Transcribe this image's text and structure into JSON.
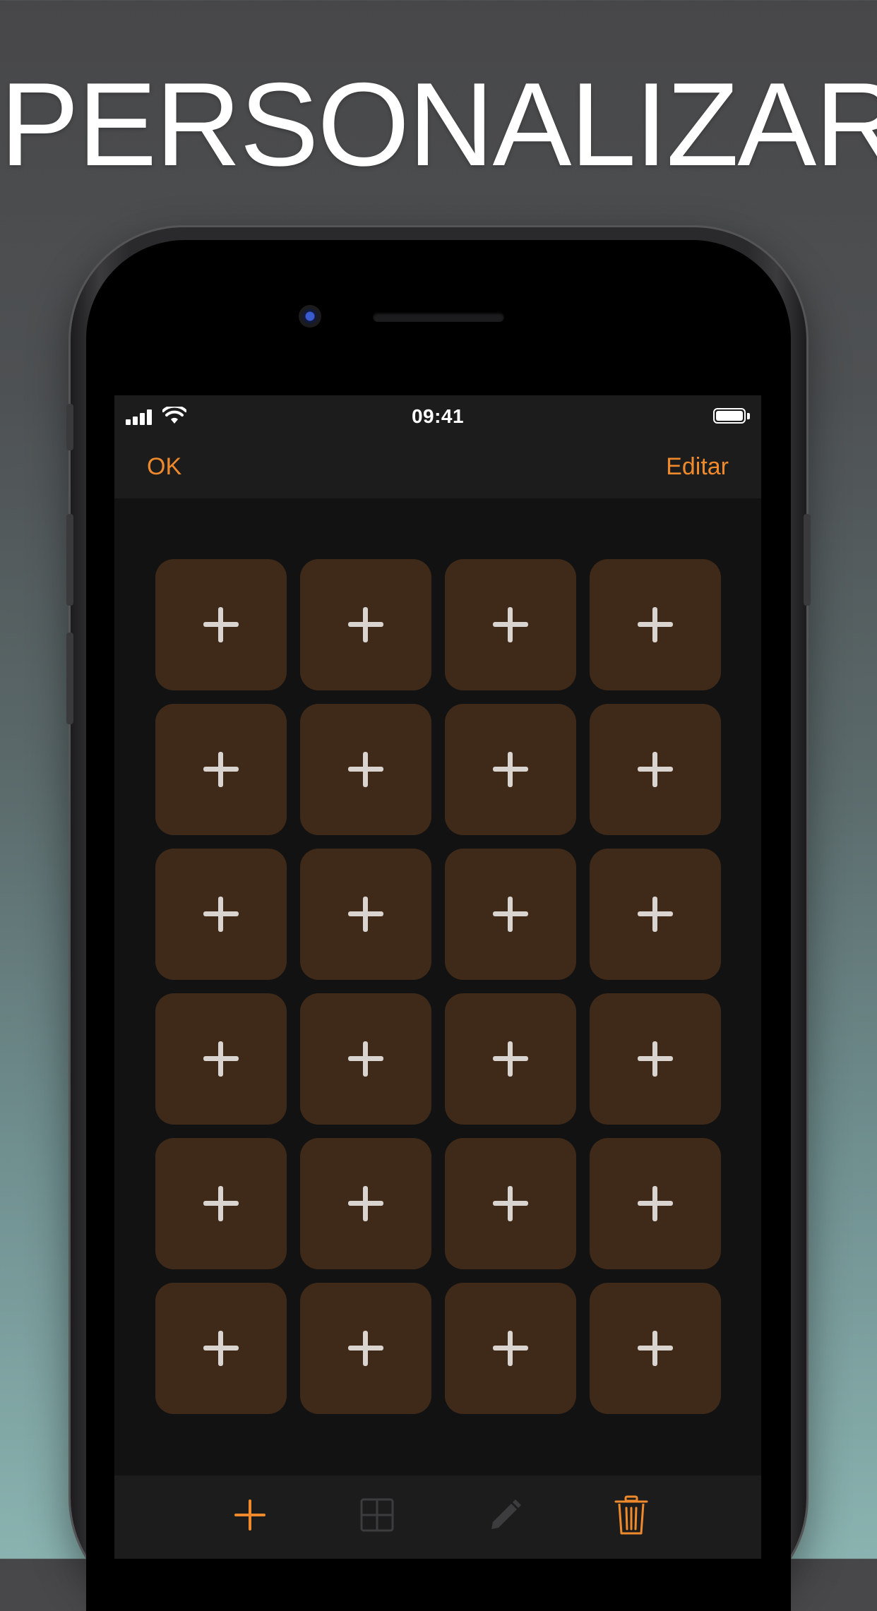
{
  "headline": "PERSONALIZAR",
  "status_bar": {
    "time": "09:41",
    "signal_icon": "cellular-signal-icon",
    "wifi_icon": "wifi-icon",
    "battery_icon": "battery-icon"
  },
  "nav": {
    "left_label": "OK",
    "right_label": "Editar"
  },
  "grid": {
    "rows": 6,
    "columns": 4,
    "tile_icon": "plus-icon"
  },
  "toolbar": {
    "items": [
      {
        "icon": "add-icon",
        "enabled": true
      },
      {
        "icon": "grid-icon",
        "enabled": false
      },
      {
        "icon": "pencil-icon",
        "enabled": false
      },
      {
        "icon": "trash-icon",
        "enabled": true
      }
    ]
  },
  "colors": {
    "accent": "#ee8a2c",
    "tile_background": "#3f2a19",
    "tile_plus": "#d9d4cf",
    "screen_background": "#121212",
    "bar_background": "#1c1c1c",
    "disabled_icon": "#3c3c3e"
  }
}
